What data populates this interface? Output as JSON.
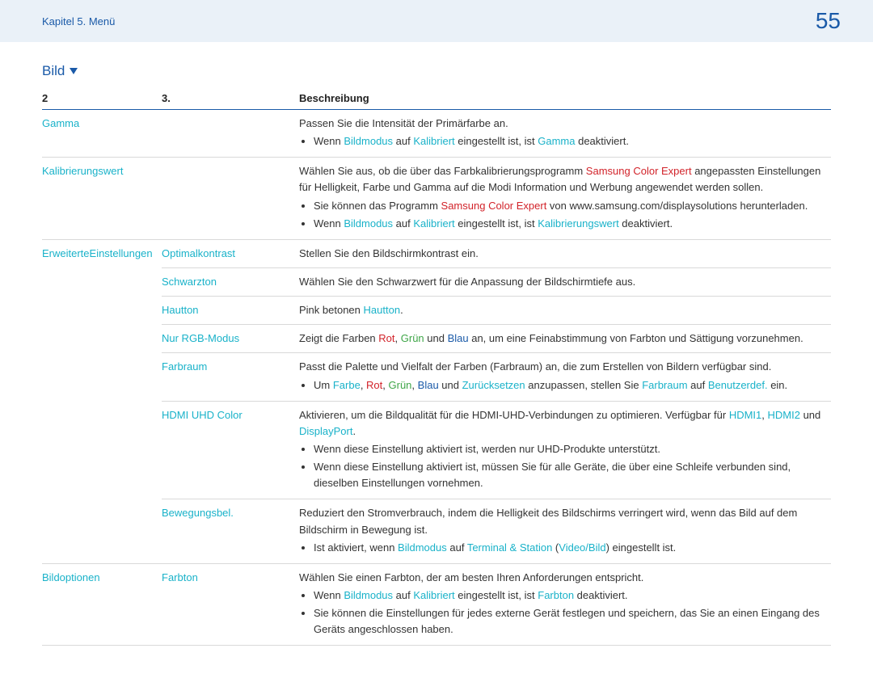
{
  "header": {
    "breadcrumb": "Kapitel 5. Menü",
    "page": "55"
  },
  "section": {
    "title": "Bild"
  },
  "table": {
    "head": {
      "c1": "2",
      "c2": "3.",
      "c3": "Beschreibung"
    },
    "gamma": {
      "label": "Gamma",
      "desc": "Passen Sie die Intensität der Primärfarbe an.",
      "b1_prefix": "Wenn ",
      "b1_link1": "Bildmodus",
      "b1_mid1": " auf ",
      "b1_link2": "Kalibriert",
      "b1_mid2": " eingestellt ist, ist ",
      "b1_link3": "Gamma",
      "b1_suffix": " deaktiviert."
    },
    "kalib": {
      "label": "Kalibrierungswert",
      "desc_prefix": "Wählen Sie aus, ob die über das Farbkalibrierungsprogramm ",
      "desc_red": "Samsung Color Expert",
      "desc_suffix": " angepassten Einstellungen für Helligkeit, Farbe und Gamma auf die Modi Information und Werbung angewendet werden sollen.",
      "b1_prefix": "Sie können das Programm ",
      "b1_red": "Samsung Color Expert",
      "b1_suffix": " von www.samsung.com/displaysolutions herunterladen.",
      "b2_prefix": "Wenn ",
      "b2_link1": "Bildmodus",
      "b2_mid1": " auf ",
      "b2_link2": "Kalibriert",
      "b2_mid2": " eingestellt ist, ist ",
      "b2_link3": "Kalibrierungswert",
      "b2_suffix": " deaktiviert."
    },
    "erw": {
      "label": "ErweiterteEinstellungen",
      "optimal": {
        "label": "Optimalkontrast",
        "desc": "Stellen Sie den Bildschirmkontrast ein."
      },
      "schwarz": {
        "label": "Schwarzton",
        "desc": "Wählen Sie den Schwarzwert für die Anpassung der Bildschirmtiefe aus."
      },
      "haut": {
        "label": "Hautton",
        "prefix": "Pink betonen ",
        "link": "Hautton",
        "suffix": "."
      },
      "rgb": {
        "label": "Nur RGB-Modus",
        "prefix": "Zeigt die Farben ",
        "rot": "Rot",
        "sep1": ", ",
        "gruen": "Grün",
        "sep2": " und ",
        "blau": "Blau",
        "suffix": " an, um eine Feinabstimmung von Farbton und Sättigung vorzunehmen."
      },
      "farbraum": {
        "label": "Farbraum",
        "desc": "Passt die Palette und Vielfalt der Farben (Farbraum) an, die zum Erstellen von Bildern verfügbar sind.",
        "b1_prefix": "Um ",
        "b1_farbe": "Farbe",
        "b1_s1": ", ",
        "b1_rot": "Rot",
        "b1_s2": ", ",
        "b1_gruen": "Grün",
        "b1_s3": ", ",
        "b1_blau": "Blau",
        "b1_s4": " und ",
        "b1_reset": "Zurücksetzen",
        "b1_mid": " anzupassen, stellen Sie ",
        "b1_farbraum": "Farbraum",
        "b1_auf": " auf ",
        "b1_benutzer": "Benutzerdef.",
        "b1_suffix": " ein."
      },
      "hdmi": {
        "label": "HDMI UHD Color",
        "desc_prefix": "Aktivieren, um die Bildqualität für die HDMI-UHD-Verbindungen zu optimieren. Verfügbar für ",
        "hdmi1": "HDMI1",
        "s1": ", ",
        "hdmi2": "HDMI2",
        "s2": " und ",
        "dp": "DisplayPort",
        "dot": ".",
        "b1": "Wenn diese Einstellung aktiviert ist, werden nur UHD-Produkte unterstützt.",
        "b2": "Wenn diese Einstellung aktiviert ist, müssen Sie für alle Geräte, die über eine Schleife verbunden sind, dieselben Einstellungen vornehmen."
      },
      "beweg": {
        "label": "Bewegungsbel.",
        "desc": "Reduziert den Stromverbrauch, indem die Helligkeit des Bildschirms verringert wird, wenn das Bild auf dem Bildschirm in Bewegung ist.",
        "b1_prefix": "Ist aktiviert, wenn ",
        "b1_link1": "Bildmodus",
        "b1_mid1": " auf ",
        "b1_link2": "Terminal & Station",
        "b1_mid2": " (",
        "b1_link3": "Video/Bild",
        "b1_suffix": ") eingestellt ist."
      }
    },
    "bildopt": {
      "label": "Bildoptionen",
      "farbton": {
        "label": "Farbton",
        "desc": "Wählen Sie einen Farbton, der am besten Ihren Anforderungen entspricht.",
        "b1_prefix": "Wenn ",
        "b1_link1": "Bildmodus",
        "b1_mid1": " auf ",
        "b1_link2": "Kalibriert",
        "b1_mid2": " eingestellt ist, ist ",
        "b1_link3": "Farbton",
        "b1_suffix": " deaktiviert.",
        "b2": "Sie können die Einstellungen für jedes externe Gerät festlegen und speichern, das Sie an einen Eingang des Geräts angeschlossen haben."
      }
    }
  }
}
